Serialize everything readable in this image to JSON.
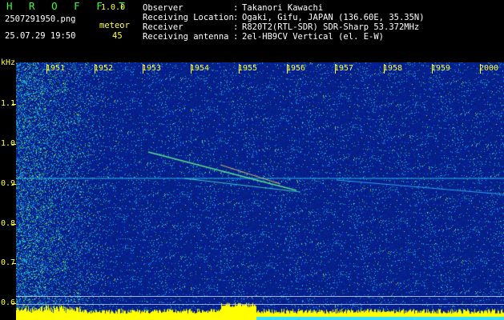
{
  "header": {
    "brand": "H R O F F T",
    "version": "1.0.0",
    "filename": "2507291950.png",
    "datetime": "25.07.29 19:50",
    "meteor_label": "meteor",
    "meteor_count": "45",
    "info": [
      {
        "key": "Observer",
        "value": "Takanori Kawachi"
      },
      {
        "key": "Receiving Location",
        "value": "Ogaki, Gifu, JAPAN (136.60E, 35.35N)"
      },
      {
        "key": "Receiver",
        "value": "R820T2(RTL-SDR) SDR-Sharp 53.372MHz"
      },
      {
        "key": "Receiving antenna",
        "value": "2el-HB9CV Vertical (el. E-W)"
      }
    ],
    "separator": ":"
  },
  "axes": {
    "y_unit": "kHz",
    "y_ticks": [
      "1.1",
      "1.0",
      "0.9",
      "0.8",
      "0.7",
      "0.6"
    ],
    "x_ticks": [
      "1951",
      "1952",
      "1953",
      "1954",
      "1955",
      "1956",
      "1957",
      "1958",
      "1959",
      "2000"
    ]
  },
  "colors": {
    "label_green": "#33ff33",
    "label_yellow": "#ffff33",
    "background_blue": "#0a1e8c",
    "signal_yellow": "#ffff00",
    "signal_cyan": "#33ddff"
  }
}
